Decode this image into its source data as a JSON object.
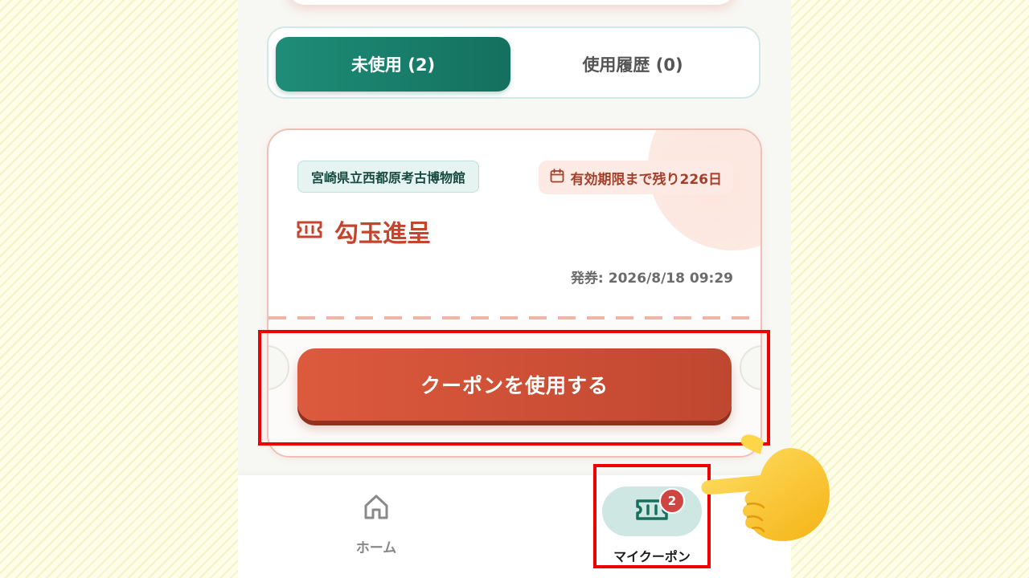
{
  "tabs": {
    "unused": "未使用 (2)",
    "history": "使用履歴 (0)"
  },
  "coupon": {
    "venue": "宮崎県立西都原考古博物館",
    "expiry": "有効期限まで残り226日",
    "title": "勾玉進呈",
    "issued_label": "発券:",
    "issued_value": "2026/8/18 09:29",
    "use_button": "クーポンを使用する"
  },
  "bottom_nav": {
    "home_label": "ホーム",
    "coupon_label": "マイクーポン",
    "coupon_badge": "2"
  },
  "colors": {
    "accent_green": "#1e8d77",
    "accent_red": "#d4543a",
    "highlight_red": "#ee0000"
  },
  "icons": {
    "tab_none": "",
    "expiry": "calendar-icon",
    "title": "ticket-icon",
    "home": "home-icon",
    "coupon": "ticket-icon",
    "annotation": "pointing-hand-icon"
  }
}
